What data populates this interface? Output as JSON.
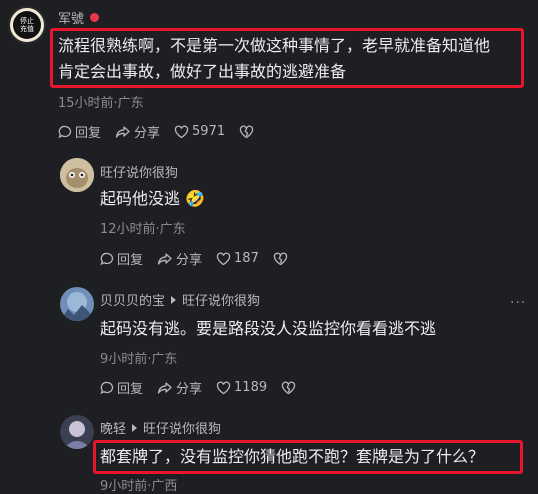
{
  "comments": [
    {
      "user": "军號",
      "avatar_text": [
        "停止",
        "充值"
      ],
      "lines": [
        "流程很熟练啊，不是第一次做这种事情了，老早就准备知道他",
        "肯定会出事故，做好了出事故的逃避准备"
      ],
      "meta": "15小时前·广东",
      "reply_label": "回复",
      "share_label": "分享",
      "likes": "5971"
    },
    {
      "user": "旺仔说你很狗",
      "lines": [
        "起码他没逃 🤣"
      ],
      "meta": "12小时前·广东",
      "reply_label": "回复",
      "share_label": "分享",
      "likes": "187"
    },
    {
      "user": "贝贝贝的宝",
      "reply_to": "旺仔说你很狗",
      "lines": [
        "起码没有逃。要是路段没人没监控你看看逃不逃"
      ],
      "meta": "9小时前·广东",
      "reply_label": "回复",
      "share_label": "分享",
      "likes": "1189"
    },
    {
      "user": "晚轻",
      "reply_to": "旺仔说你很狗",
      "lines": [
        "都套牌了，没有监控你猜他跑不跑？套牌是为了什么？"
      ],
      "meta": "9小时前·广西"
    }
  ],
  "more_label": "···",
  "highlight_color": "#e6162d"
}
